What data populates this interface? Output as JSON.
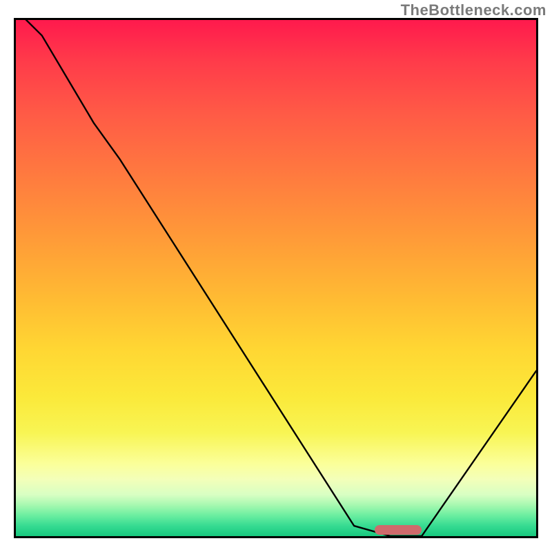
{
  "watermark": "TheBottleneck.com",
  "colors": {
    "gradient_top": "#ff1a4d",
    "gradient_bottom": "#18c97f",
    "curve": "#000000",
    "marker": "#cf6a6c"
  },
  "chart_data": {
    "type": "line",
    "title": "",
    "xlabel": "",
    "ylabel": "",
    "xlim": [
      0,
      100
    ],
    "ylim": [
      0,
      100
    ],
    "x": [
      0,
      5,
      15,
      20,
      65,
      72,
      78,
      100
    ],
    "values": [
      102,
      97,
      80,
      73,
      2,
      0,
      0,
      32
    ],
    "marker": {
      "x_start": 69,
      "x_end": 78,
      "y": 1.2
    },
    "grid": false,
    "legend": false
  }
}
